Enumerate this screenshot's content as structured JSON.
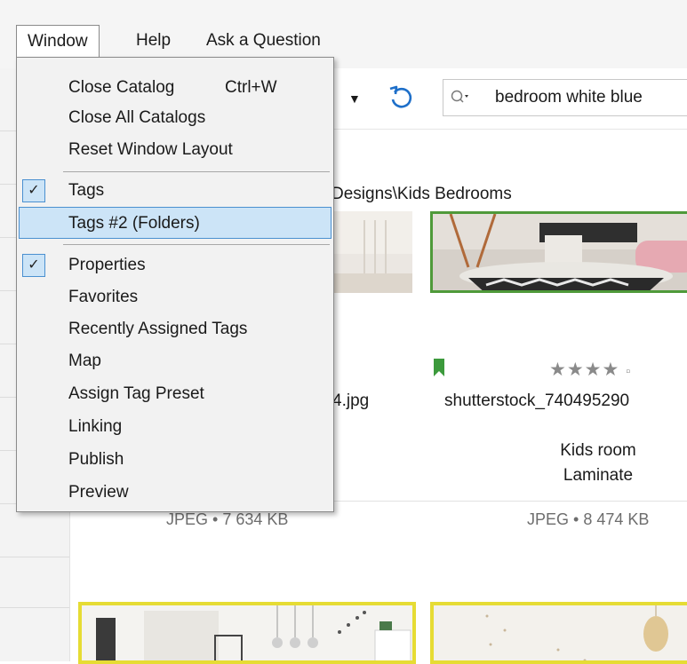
{
  "menubar": {
    "items": [
      {
        "label": "Window",
        "active": true
      },
      {
        "label": "Help"
      },
      {
        "label": "Ask a Question"
      }
    ]
  },
  "window_menu": {
    "items": [
      {
        "label": "Close Catalog",
        "shortcut": "Ctrl+W"
      },
      {
        "label": "Close All Catalogs"
      },
      {
        "label": "Reset Window Layout"
      },
      {
        "label": "Tags",
        "checked": true
      },
      {
        "label": "Tags #2 (Folders)",
        "highlighted": true
      },
      {
        "label": "Properties",
        "checked": true
      },
      {
        "label": "Favorites"
      },
      {
        "label": "Recently Assigned Tags"
      },
      {
        "label": "Map"
      },
      {
        "label": "Assign Tag Preset"
      },
      {
        "label": "Linking"
      },
      {
        "label": "Publish"
      },
      {
        "label": "Preview"
      }
    ]
  },
  "toolbar": {
    "search_value": "bedroom white blue",
    "icons": [
      "chevron-down-icon",
      "undo-icon",
      "search-icon"
    ]
  },
  "browser": {
    "path": "Designs\\Kids Bedrooms",
    "files": [
      {
        "name_partial": "4.jpg",
        "meta": "JPEG • 7 634 KB"
      },
      {
        "name": "shutterstock_740495290",
        "rating_stars": "★★★★",
        "rating_dot": "▫",
        "bookmark_color": "#3c9a3c",
        "tags": [
          "Kids room",
          "Laminate"
        ],
        "meta": "JPEG • 8 474 KB"
      }
    ]
  },
  "colors": {
    "menu_highlight": "#cce4f7",
    "menu_highlight_border": "#4a90d0",
    "selected_thumb_border": "#4f9a3a",
    "tagged_thumb_border": "#e6dc34"
  }
}
